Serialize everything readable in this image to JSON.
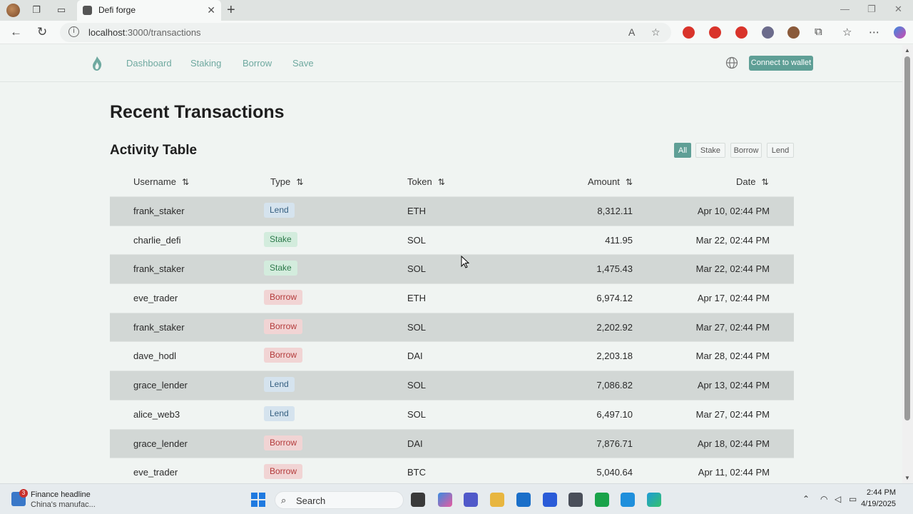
{
  "browser": {
    "tab_title": "Defi forge",
    "url_host": "localhost",
    "url_path": ":3000/transactions",
    "new_tab": "+",
    "close": "✕"
  },
  "app": {
    "nav": [
      "Dashboard",
      "Staking",
      "Borrow",
      "Save"
    ],
    "connect_label": "Connect to wallet"
  },
  "page": {
    "title": "Recent Transactions",
    "section_title": "Activity Table",
    "filters": [
      "All",
      "Stake",
      "Borrow",
      "Lend"
    ],
    "active_filter": "All",
    "columns": [
      "Username",
      "Type",
      "Token",
      "Amount",
      "Date"
    ],
    "rows": [
      {
        "username": "frank_staker",
        "type": "Lend",
        "token": "ETH",
        "amount": "8,312.11",
        "date": "Apr 10, 02:44 PM"
      },
      {
        "username": "charlie_defi",
        "type": "Stake",
        "token": "SOL",
        "amount": "411.95",
        "date": "Mar 22, 02:44 PM"
      },
      {
        "username": "frank_staker",
        "type": "Stake",
        "token": "SOL",
        "amount": "1,475.43",
        "date": "Mar 22, 02:44 PM"
      },
      {
        "username": "eve_trader",
        "type": "Borrow",
        "token": "ETH",
        "amount": "6,974.12",
        "date": "Apr 17, 02:44 PM"
      },
      {
        "username": "frank_staker",
        "type": "Borrow",
        "token": "SOL",
        "amount": "2,202.92",
        "date": "Mar 27, 02:44 PM"
      },
      {
        "username": "dave_hodl",
        "type": "Borrow",
        "token": "DAI",
        "amount": "2,203.18",
        "date": "Mar 28, 02:44 PM"
      },
      {
        "username": "grace_lender",
        "type": "Lend",
        "token": "SOL",
        "amount": "7,086.82",
        "date": "Apr 13, 02:44 PM"
      },
      {
        "username": "alice_web3",
        "type": "Lend",
        "token": "SOL",
        "amount": "6,497.10",
        "date": "Mar 27, 02:44 PM"
      },
      {
        "username": "grace_lender",
        "type": "Borrow",
        "token": "DAI",
        "amount": "7,876.71",
        "date": "Apr 18, 02:44 PM"
      },
      {
        "username": "eve_trader",
        "type": "Borrow",
        "token": "BTC",
        "amount": "5,040.64",
        "date": "Apr 11, 02:44 PM"
      }
    ]
  },
  "taskbar": {
    "widget_count": "3",
    "widget_title": "Finance headline",
    "widget_sub": "China's manufac...",
    "search_label": "Search",
    "time": "2:44 PM",
    "date": "4/19/2025"
  },
  "colors": {
    "accent": "#5f9f96",
    "nav_link": "#6fa9a0",
    "lend": "#355f80",
    "stake": "#2e7a4c",
    "borrow": "#b33a3a"
  }
}
